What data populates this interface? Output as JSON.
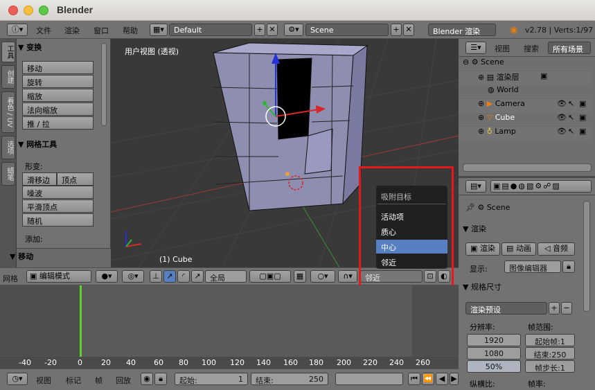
{
  "window": {
    "title": "Blender"
  },
  "info_bar": {
    "menus": [
      "文件",
      "渲染",
      "窗口",
      "帮助"
    ],
    "layout": "Default",
    "scene": "Scene",
    "engine": "Blender 渲染",
    "version": "v2.78 | Verts:1/97"
  },
  "tool_tabs": [
    "工具",
    "创建",
    "着色 / UV",
    "选项",
    "蜡笔"
  ],
  "tool_shelf": {
    "transform_title": "变换",
    "transform_buttons": [
      "移动",
      "旋转",
      "缩放",
      "法向缩放",
      "推 / 拉"
    ],
    "mesh_tools_title": "网格工具",
    "deform_label": "形变:",
    "deform_buttons": [
      "滑移边",
      "顶点"
    ],
    "more_buttons": [
      "噪波",
      "平滑顶点",
      "随机"
    ],
    "add_label": "添加:",
    "move_panel": "移动"
  },
  "viewport": {
    "view_label": "用户视图 (透视)",
    "object_label": "(1) Cube"
  },
  "snap_popup": {
    "title": "吸附目标",
    "items": [
      "活动项",
      "质心",
      "中心",
      "邻近"
    ],
    "selected_index": 2
  },
  "view3d_header": {
    "editor_label": "网格",
    "mode": "编辑模式",
    "orientation": "全局",
    "snap_target": "邻近"
  },
  "timeline": {
    "ruler_ticks": [
      "-40",
      "-20",
      "0",
      "20",
      "40",
      "60",
      "80",
      "100",
      "120",
      "140",
      "160",
      "180",
      "200",
      "220",
      "240",
      "260"
    ],
    "current_frame": 1,
    "menus": [
      "视图",
      "标记",
      "帧",
      "回放"
    ],
    "start_label": "起始:",
    "start_value": "1",
    "end_label": "结束:",
    "end_value": "250"
  },
  "outliner": {
    "header_menus": [
      "视图",
      "搜索"
    ],
    "filter": "所有场景",
    "rows": [
      "Scene",
      "渲染层",
      "World",
      "Camera",
      "Cube",
      "Lamp"
    ]
  },
  "properties": {
    "context": "Scene",
    "render_section": "渲染",
    "render_buttons": [
      "渲染",
      "动画",
      "音频"
    ],
    "display_label": "显示:",
    "display_value": "图像编辑器",
    "dimensions_section": "规格尺寸",
    "render_preset": "渲染预设",
    "resolution_label": "分辨率:",
    "frame_range_label": "帧范围:",
    "res_x": "1920",
    "res_y": "1080",
    "res_pct": "50%",
    "start_frame": "起始帧:1",
    "end_frame": "结束:250",
    "frame_step": "帧步长:1",
    "aspect_label": "纵横比:",
    "frame_rate_label": "帧率:"
  },
  "colors": {
    "accent": "#5680c2",
    "highlight_box": "#e5191b",
    "timeline_cursor": "#5fd12b"
  }
}
